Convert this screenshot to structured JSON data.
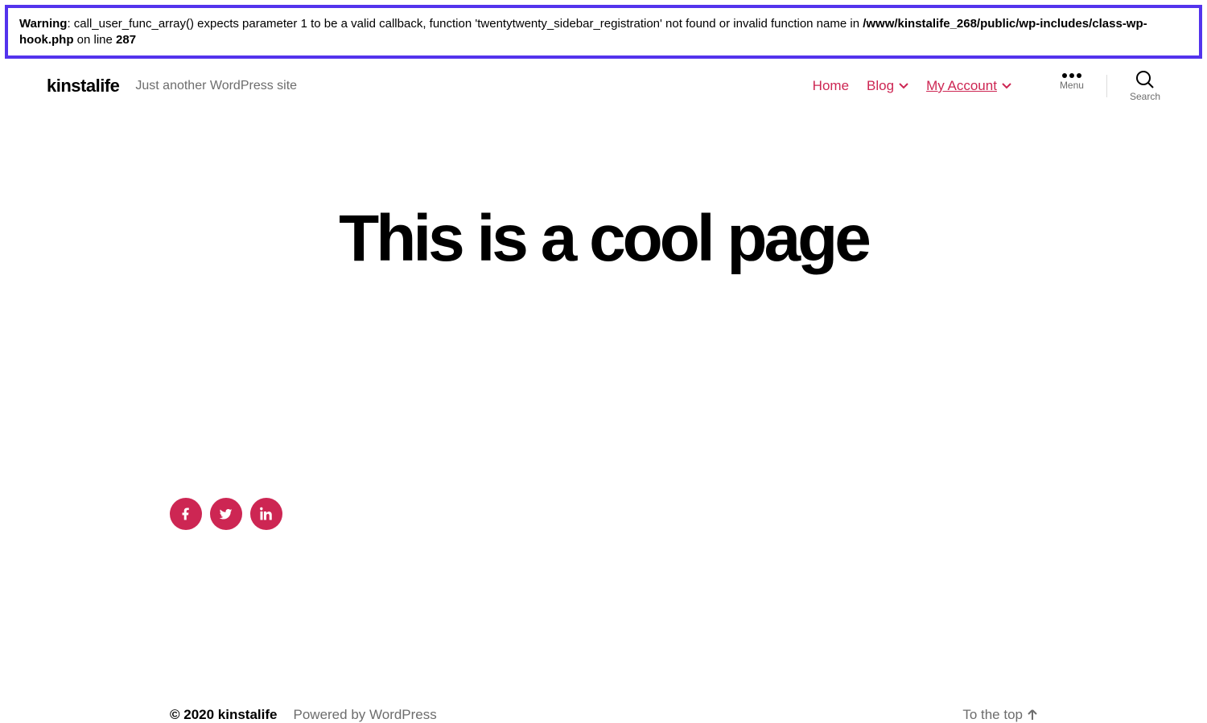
{
  "warning": {
    "label": "Warning",
    "msg_part1": ": call_user_func_array() expects parameter 1 to be a valid callback, function 'twentytwenty_sidebar_registration' not found or invalid function name in ",
    "file_path": "/www/kinstalife_268/public/wp-includes/class-wp-hook.php",
    "on_line_text": " on line ",
    "line_number": "287"
  },
  "header": {
    "site_title": "kinstalife",
    "tagline": "Just another WordPress site",
    "nav": {
      "home": "Home",
      "blog": "Blog",
      "account": "My Account"
    },
    "menu_label": "Menu",
    "search_label": "Search"
  },
  "page": {
    "title": "This is a cool page"
  },
  "social": {
    "facebook": "facebook-icon",
    "twitter": "twitter-icon",
    "linkedin": "linkedin-icon"
  },
  "footer": {
    "copyright": "© 2020 kinstalife",
    "powered": "Powered by WordPress",
    "to_top": "To the top"
  },
  "colors": {
    "accent": "#cd2653",
    "highlight_border": "#5333ed"
  }
}
